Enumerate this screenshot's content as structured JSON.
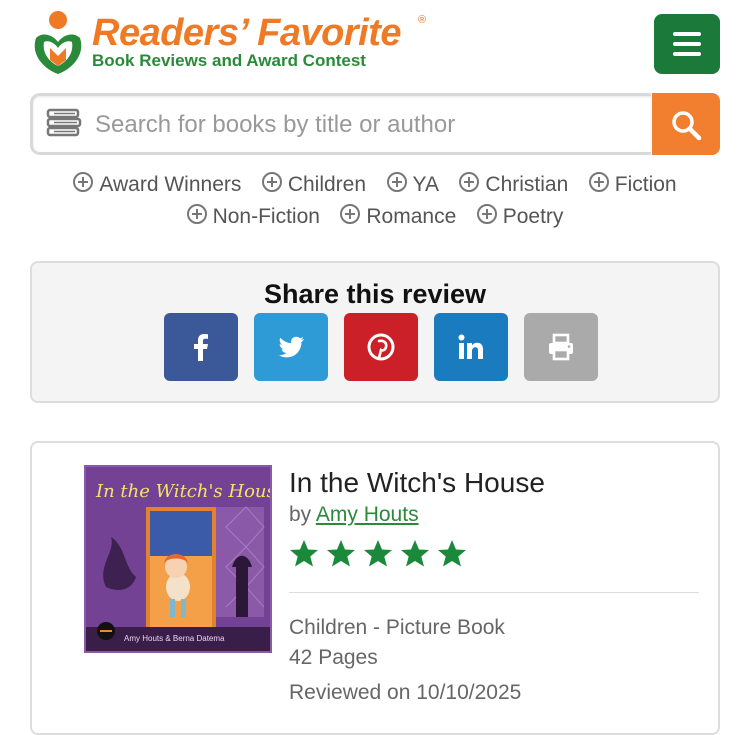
{
  "header": {
    "logo_title": "Readers’ Favorite",
    "logo_reg": "®",
    "logo_subtitle": "Book Reviews and Award Contest",
    "colors": {
      "orange": "#ef7a26",
      "green": "#2a8a3a",
      "menu": "#1b7a3a"
    }
  },
  "search": {
    "placeholder": "Search for books by title or author",
    "value": ""
  },
  "categories": {
    "row1": [
      "Award Winners",
      "Children",
      "YA",
      "Christian",
      "Fiction"
    ],
    "row2": [
      "Non-Fiction",
      "Romance",
      "Poetry"
    ]
  },
  "share": {
    "title": "Share this review",
    "buttons": [
      {
        "name": "facebook",
        "icon": "facebook-icon",
        "color": "#3b5998"
      },
      {
        "name": "twitter",
        "icon": "twitter-icon",
        "color": "#2f9bd6"
      },
      {
        "name": "pinterest",
        "icon": "pinterest-icon",
        "color": "#cb2027"
      },
      {
        "name": "linkedin",
        "icon": "linkedin-icon",
        "color": "#1a7bbf"
      },
      {
        "name": "print",
        "icon": "print-icon",
        "color": "#aaaaaa"
      }
    ]
  },
  "review": {
    "cover_title": "In the Witch's House",
    "cover_authors": "Amy Houts & Berna Datema",
    "title": "In the Witch's House",
    "by": "by",
    "author": "Amy Houts",
    "rating": 5,
    "rating_max": 5,
    "genre": "Children - Picture Book",
    "pages": "42 Pages",
    "reviewed": "Reviewed on 10/10/2025"
  }
}
